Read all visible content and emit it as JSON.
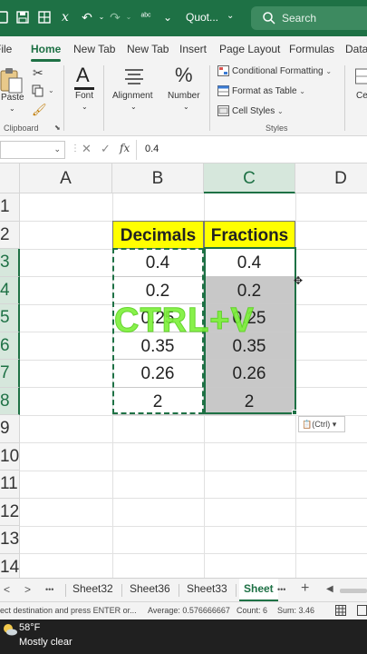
{
  "titlebar": {
    "doc_name": "Quot...",
    "search_placeholder": "Search",
    "caret": "⌄",
    "icons": [
      "excel-autosave-icon",
      "save-icon",
      "data-icon",
      "formula-icon",
      "undo-icon",
      "redo-icon",
      "spellcheck-icon",
      "more-icon"
    ]
  },
  "ribbon_tabs": [
    {
      "label": "File"
    },
    {
      "label": "Home",
      "active": true
    },
    {
      "label": "New Tab"
    },
    {
      "label": "New Tab"
    },
    {
      "label": "Insert"
    },
    {
      "label": "Page Layout"
    },
    {
      "label": "Formulas"
    },
    {
      "label": "Data"
    }
  ],
  "ribbon": {
    "clipboard": {
      "paste_label": "Paste",
      "group_label": "Clipboard"
    },
    "font": {
      "label": "Font"
    },
    "alignment": {
      "label": "Alignment"
    },
    "number": {
      "label": "Number",
      "icon_text": "%"
    },
    "styles": {
      "conditional_formatting": "Conditional Formatting",
      "format_as_table": "Format as Table",
      "cell_styles": "Cell Styles",
      "group_label": "Styles"
    },
    "cells_partial": "Ce"
  },
  "formula_bar": {
    "name_box": "",
    "cancel_symbol": "✕",
    "enter_symbol": "✓",
    "fx_symbol": "fx",
    "value": "0.4"
  },
  "grid": {
    "columns": [
      "A",
      "B",
      "C",
      "D"
    ],
    "rows": [
      "1",
      "2",
      "3",
      "4",
      "5",
      "6",
      "7",
      "8",
      "9",
      "10",
      "11",
      "12",
      "13",
      "14"
    ],
    "header_row": {
      "b": "Decimals",
      "c": "Fractions"
    },
    "data": [
      {
        "b": "0.4",
        "c": "0.4"
      },
      {
        "b": "0.2",
        "c": "0.2"
      },
      {
        "b": "0.25",
        "c": "0.25"
      },
      {
        "b": "0.35",
        "c": "0.35"
      },
      {
        "b": "0.26",
        "c": "0.26"
      },
      {
        "b": "2",
        "c": "2"
      }
    ],
    "overlay_text": "CTRL+V",
    "paste_options_label": "(Ctrl) ▾"
  },
  "sheet_tabs": {
    "nav_prev": "<",
    "nav_next": ">",
    "more": "•••",
    "tabs": [
      {
        "label": "Sheet32"
      },
      {
        "label": "Sheet36"
      },
      {
        "label": "Sheet33"
      },
      {
        "label": "Sheet",
        "active": true
      }
    ],
    "more_right": "•••",
    "add": "+"
  },
  "status_bar": {
    "message": "ect destination and press ENTER or...",
    "average": "Average: 0.576666667",
    "count": "Count: 6",
    "sum": "Sum: 3.46"
  },
  "taskbar": {
    "temperature": "58°F",
    "condition": "Mostly clear"
  },
  "colors": {
    "excel_green": "#1e7145",
    "header_fill": "#ffff00",
    "selected_fill": "#c8c8c8",
    "overlay": "#7ef03c"
  }
}
